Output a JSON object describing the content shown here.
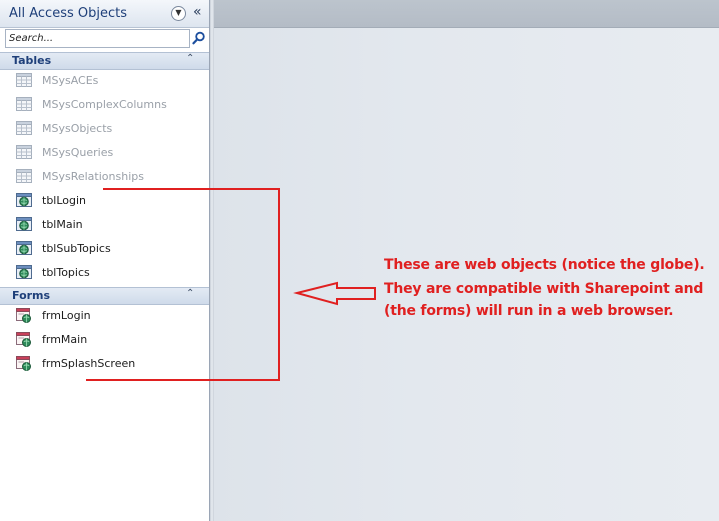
{
  "nav": {
    "title": "All Access Objects",
    "dropdown_icon": "circle-chevron-down-icon",
    "collapse_icon": "double-chevron-left-icon",
    "search": {
      "placeholder": "Search...",
      "icon": "magnifier-icon"
    },
    "groups": [
      {
        "label": "Tables",
        "items": [
          {
            "label": "MSysACEs",
            "icon": "table-icon",
            "system": true
          },
          {
            "label": "MSysComplexColumns",
            "icon": "table-icon",
            "system": true
          },
          {
            "label": "MSysObjects",
            "icon": "table-icon",
            "system": true
          },
          {
            "label": "MSysQueries",
            "icon": "table-icon",
            "system": true
          },
          {
            "label": "MSysRelationships",
            "icon": "table-icon",
            "system": true
          },
          {
            "label": "tblLogin",
            "icon": "web-table-icon",
            "system": false
          },
          {
            "label": "tblMain",
            "icon": "web-table-icon",
            "system": false
          },
          {
            "label": "tblSubTopics",
            "icon": "web-table-icon",
            "system": false
          },
          {
            "label": "tblTopics",
            "icon": "web-table-icon",
            "system": false
          }
        ]
      },
      {
        "label": "Forms",
        "items": [
          {
            "label": "frmLogin",
            "icon": "web-form-icon"
          },
          {
            "label": "frmMain",
            "icon": "web-form-icon"
          },
          {
            "label": "frmSplashScreen",
            "icon": "web-form-icon"
          }
        ]
      }
    ]
  },
  "annotation": {
    "lines": [
      "These are web objects (notice the globe).",
      "They are compatible with Sharepoint and",
      "(the forms) will run in a web browser."
    ],
    "color": "#e02020"
  },
  "colors": {
    "nav_title": "#1e3f79",
    "system_item_text": "#9aa0a8",
    "workspace_bg": "#e3e8ee"
  }
}
